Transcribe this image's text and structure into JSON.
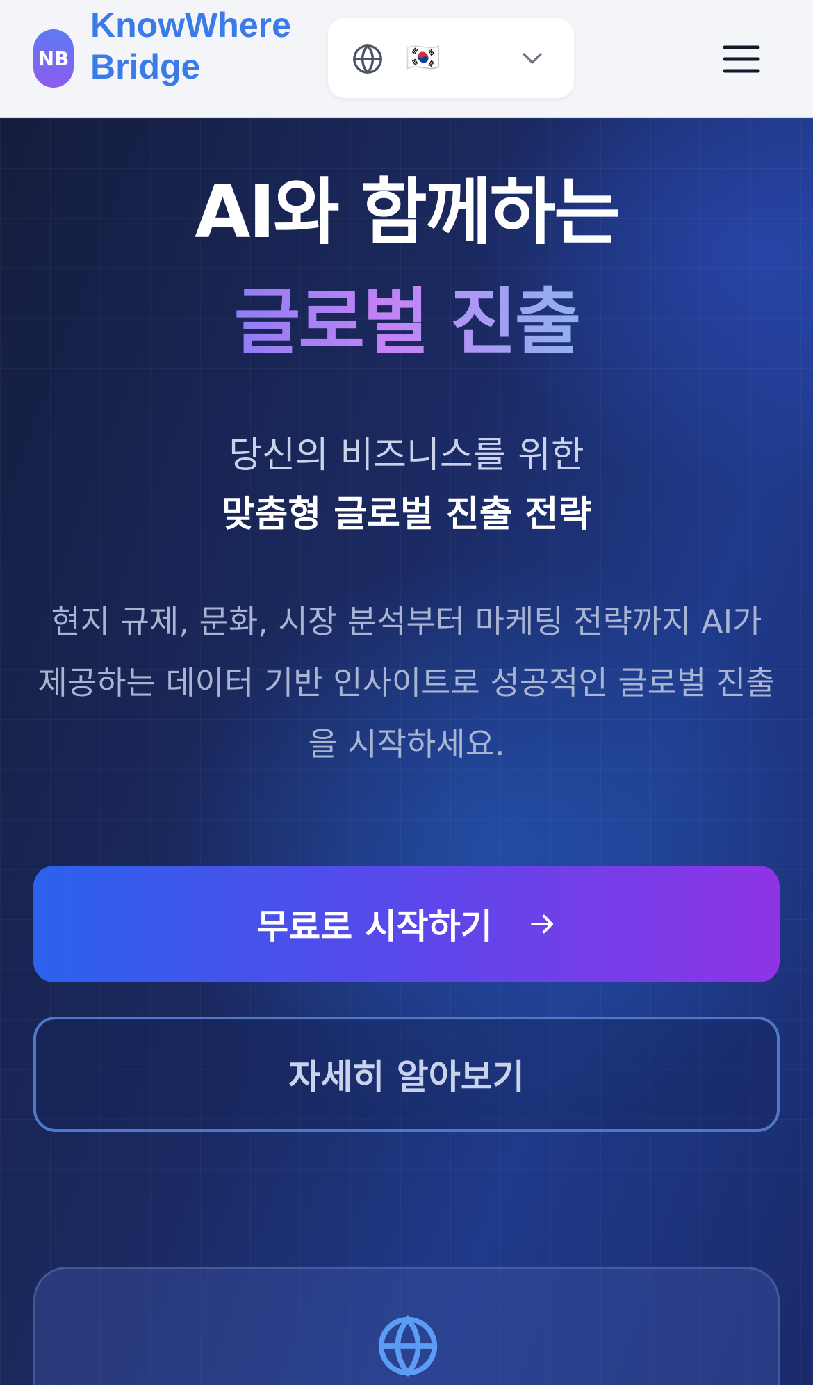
{
  "header": {
    "logo_initials": "NB",
    "brand_line1": "KnowWhere",
    "brand_line2": "Bridge",
    "language_flag": "🇰🇷",
    "menu_icon": "hamburger-menu-icon",
    "language_icon": "globe-icon"
  },
  "hero": {
    "title_line1": "AI와 함께하는",
    "title_line2": "글로벌 진출",
    "subtitle_line1": "당신의 비즈니스를 위한",
    "subtitle_line2": "맞춤형 글로벌 진출 전략",
    "description": "현지 규제, 문화, 시장 분석부터 마케팅 전략까지 AI가 제공하는 데이터 기반 인사이트로 성공적인 글로벌 진출을 시작하세요.",
    "primary_cta": "무료로 시작하기",
    "secondary_cta": "자세히 알아보기"
  },
  "colors": {
    "brand_blue": "#3b7be8",
    "primary_gradient_start": "#2b62ec",
    "primary_gradient_end": "#8e34e6",
    "hero_background": "#1b2a63"
  }
}
